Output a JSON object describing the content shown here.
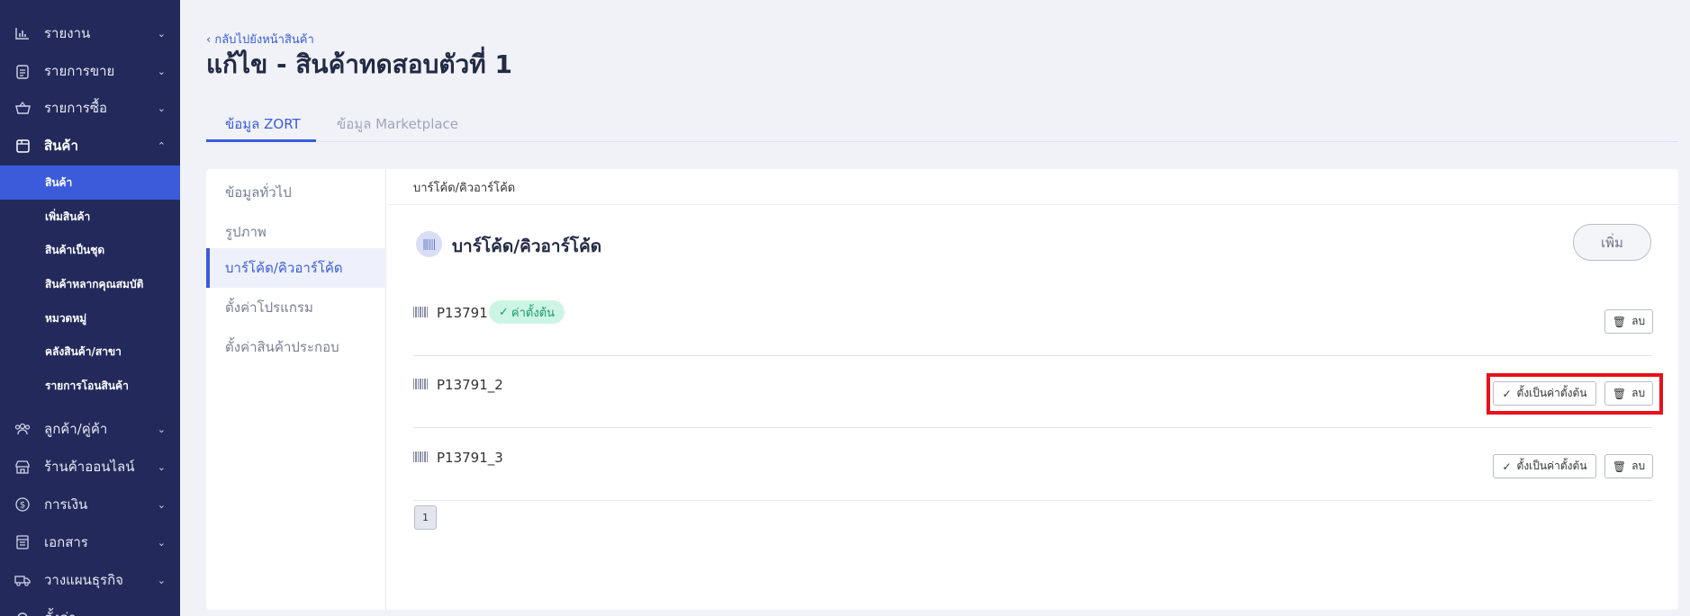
{
  "sidebar": {
    "items": [
      {
        "label": "รายงาน",
        "icon": "chart-icon"
      },
      {
        "label": "รายการขาย",
        "icon": "clipboard-icon"
      },
      {
        "label": "รายการซื้อ",
        "icon": "basket-icon"
      },
      {
        "label": "สินค้า",
        "icon": "box-icon"
      },
      {
        "label": "ลูกค้า/คู่ค้า",
        "icon": "users-icon"
      },
      {
        "label": "ร้านค้าออนไลน์",
        "icon": "store-icon"
      },
      {
        "label": "การเงิน",
        "icon": "dollar-icon"
      },
      {
        "label": "เอกสาร",
        "icon": "document-icon"
      },
      {
        "label": "วางแผนธุรกิจ",
        "icon": "truck-icon"
      },
      {
        "label": "ตั้งค่า",
        "icon": "gear-icon"
      }
    ],
    "product_sub": [
      {
        "label": "สินค้า"
      },
      {
        "label": "เพิ่มสินค้า"
      },
      {
        "label": "สินค้าเป็นชุด"
      },
      {
        "label": "สินค้าหลากคุณสมบัติ"
      },
      {
        "label": "หมวดหมู่"
      },
      {
        "label": "คลังสินค้า/สาขา"
      },
      {
        "label": "รายการโอนสินค้า"
      }
    ]
  },
  "header": {
    "back_label": "กลับไปยังหน้าสินค้า",
    "title": "แก้ไข - สินค้าทดสอบตัวที่ 1"
  },
  "tabs": [
    {
      "label": "ข้อมูล ZORT"
    },
    {
      "label": "ข้อมูล Marketplace"
    }
  ],
  "leftnav": [
    {
      "label": "ข้อมูลทั่วไป"
    },
    {
      "label": "รูปภาพ"
    },
    {
      "label": "บาร์โค้ด/คิวอาร์โค้ด"
    },
    {
      "label": "ตั้งค่าโปรแกรม"
    },
    {
      "label": "ตั้งค่าสินค้าประกอบ"
    }
  ],
  "content": {
    "breadcrumb": "บาร์โค้ด/คิวอาร์โค้ด",
    "section_title": "บาร์โค้ด/คิวอาร์โค้ด",
    "add_label": "เพิ่ม",
    "default_badge": "ค่าตั้งต้น",
    "set_default_label": "ตั้งเป็นค่าตั้งต้น",
    "delete_label": "ลบ",
    "barcodes": [
      {
        "code": "P13791"
      },
      {
        "code": "P13791_2"
      },
      {
        "code": "P13791_3"
      }
    ],
    "page": "1"
  },
  "colors": {
    "sidebar_bg": "#232a5b",
    "accent": "#3b5bdb",
    "highlight": "#e8101a",
    "badge_bg": "#cdf5e6"
  }
}
